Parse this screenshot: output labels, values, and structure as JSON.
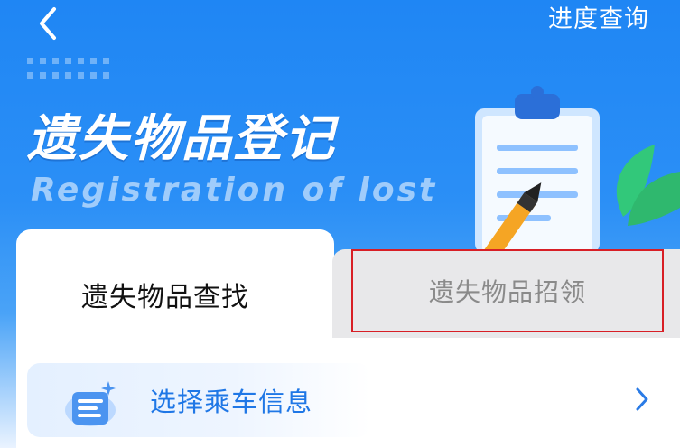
{
  "header": {
    "back_icon": "chevron-left-icon",
    "progress_link": "进度查询"
  },
  "banner": {
    "title": "遗失物品登记",
    "subtitle": "Registration of lost",
    "illustration": "clipboard-pen-icon"
  },
  "tabs": [
    {
      "label": "遗失物品查找",
      "active": true
    },
    {
      "label": "遗失物品招领",
      "active": false
    }
  ],
  "form": {
    "select_trip": {
      "label": "选择乘车信息",
      "icon": "ticket-icon",
      "arrow_icon": "chevron-right-icon"
    }
  },
  "colors": {
    "brand_blue": "#1f86f4",
    "highlight_red": "#d81f26",
    "link_blue": "#1f77e6"
  }
}
